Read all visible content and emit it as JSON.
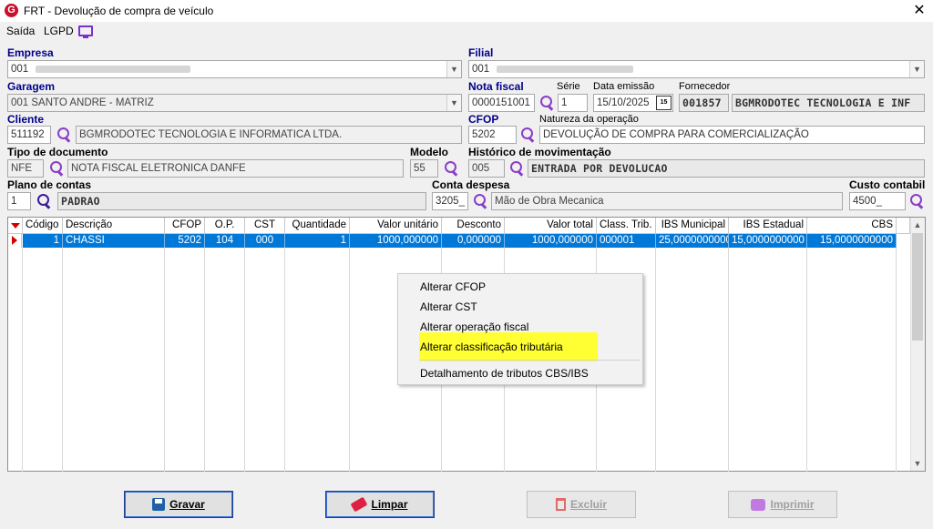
{
  "window": {
    "title": "FRT - Devolução de compra de veículo",
    "logo_letter": "G"
  },
  "menu": {
    "saida": "Saída",
    "lgpd": "LGPD"
  },
  "form": {
    "empresa": {
      "label": "Empresa",
      "value": "001"
    },
    "filial": {
      "label": "Filial",
      "value": "001"
    },
    "garagem": {
      "label": "Garagem",
      "value": "001 SANTO ANDRE - MATRIZ"
    },
    "nota_fiscal": {
      "label": "Nota fiscal",
      "value": "0000151001"
    },
    "serie": {
      "label": "Série",
      "value": "1"
    },
    "data_emissao": {
      "label": "Data emissão",
      "value": "15/10/2025",
      "icon_text": "15"
    },
    "fornecedor": {
      "label": "Fornecedor",
      "code": "001857",
      "name": "BGMRODOTEC TECNOLOGIA E INF"
    },
    "cliente": {
      "label": "Cliente",
      "code": "511192",
      "name": "BGMRODOTEC TECNOLOGIA E INFORMATICA LTDA."
    },
    "cfop": {
      "label": "CFOP",
      "value": "5202"
    },
    "natureza": {
      "label": "Natureza da operação",
      "value": "DEVOLUÇÃO DE COMPRA PARA COMERCIALIZAÇÃO"
    },
    "tipo_documento": {
      "label": "Tipo de documento",
      "code": "NFE",
      "name": "NOTA FISCAL ELETRONICA DANFE"
    },
    "modelo": {
      "label": "Modelo",
      "value": "55"
    },
    "historico": {
      "label": "Histórico de movimentação",
      "code": "005",
      "name": "ENTRADA POR DEVOLUCAO"
    },
    "plano_contas": {
      "label": "Plano de contas",
      "code": "1",
      "name": "PADRAO"
    },
    "conta_despesa": {
      "label": "Conta despesa",
      "code": "3205_",
      "name": "Mão de Obra Mecanica"
    },
    "custo_contabil": {
      "label": "Custo contabil",
      "value": "4500_"
    }
  },
  "grid": {
    "columns": [
      "Código",
      "Descrição",
      "CFOP",
      "O.P.",
      "CST",
      "Quantidade",
      "Valor unitário",
      "Desconto",
      "Valor total",
      "Class. Trib.",
      "IBS Municipal",
      "IBS Estadual",
      "CBS"
    ],
    "rows": [
      [
        "1",
        "CHASSI",
        "5202",
        "104",
        "000",
        "1",
        "1000,000000",
        "0,000000",
        "1000,000000",
        "000001",
        "25,0000000000",
        "15,0000000000",
        "15,0000000000"
      ]
    ]
  },
  "context_menu": {
    "items": [
      "Alterar CFOP",
      "Alterar CST",
      "Alterar operação fiscal",
      "Alterar classificação tributária",
      "Detalhamento de tributos CBS/IBS"
    ],
    "highlight_color": "#ffff33"
  },
  "buttons": {
    "gravar": {
      "label": "Gravar",
      "enabled": true
    },
    "limpar": {
      "label": "Limpar",
      "enabled": true
    },
    "excluir": {
      "label": "Excluir",
      "enabled": false
    },
    "imprimir": {
      "label": "Imprimir",
      "enabled": false
    }
  },
  "colors": {
    "label_blue": "#00008b",
    "selection_blue": "#0078d7",
    "search_purple": "#8a3ec8"
  }
}
